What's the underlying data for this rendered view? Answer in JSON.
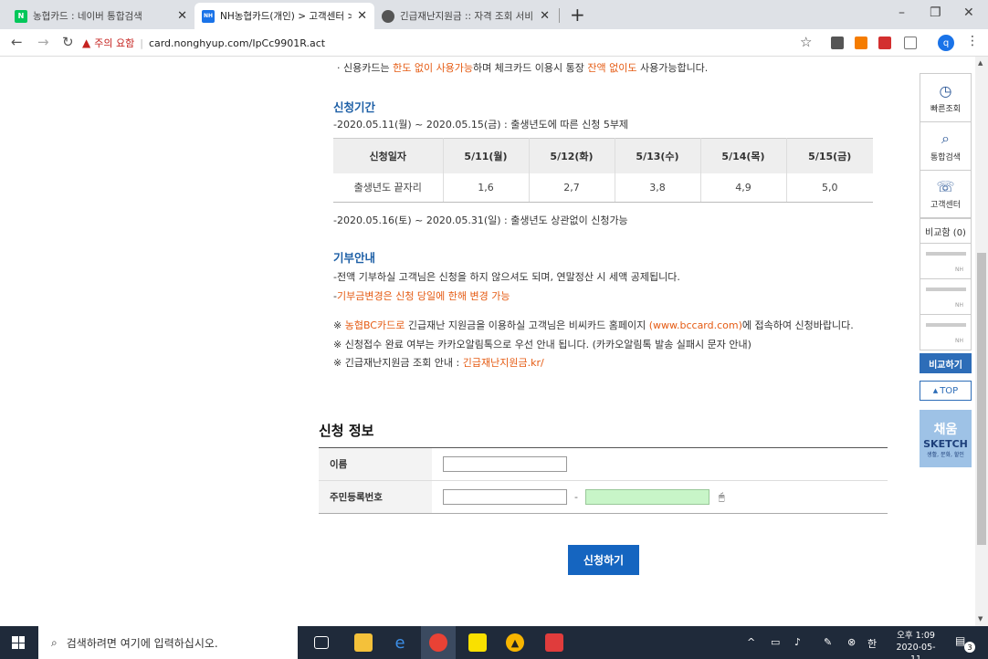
{
  "browser": {
    "tabs": [
      {
        "title": "농협카드 : 네이버 통합검색",
        "favicon": "N",
        "favicon_color": "#03c75a"
      },
      {
        "title": "NH농협카드(개인) > 고객센터 > ㅈ",
        "favicon": "NH",
        "favicon_color": "#1a73e8"
      },
      {
        "title": "긴급재난지원금 :: 자격 조회 서비",
        "favicon": "globe-icon",
        "favicon_color": "#555555"
      }
    ],
    "new_tab": "+",
    "security_warning": "주의 요함",
    "url": "card.nonghyup.com/IpCc9901R.act",
    "profile_initial": "q"
  },
  "content": {
    "top_note": {
      "prefix": "· 신용카드는 ",
      "hl1": "한도 없이 사용가능",
      "mid": "하며 체크카드 이용시 통장 ",
      "hl2": "잔액 없이도",
      "suffix": " 사용가능합니다."
    },
    "period": {
      "title": "신청기간",
      "line1": "-2020.05.11(월) ~ 2020.05.15(금) : 출생년도에 따른 신청 5부제",
      "table": {
        "headers": [
          "신청일자",
          "5/11(월)",
          "5/12(화)",
          "5/13(수)",
          "5/14(목)",
          "5/15(금)"
        ],
        "row": [
          "출생년도 끝자리",
          "1,6",
          "2,7",
          "3,8",
          "4,9",
          "5,0"
        ]
      },
      "line2": "-2020.05.16(토) ~ 2020.05.31(일) : 출생년도 상관없이 신청가능"
    },
    "donation": {
      "title": "기부안내",
      "line1": "-전액 기부하실 고객님은 신청을 하지 않으셔도 되며, 연말정산 시 세액 공제됩니다.",
      "line2_dash": "-",
      "line2_hl": "기부금변경은 신청 당일에 한해 변경 가능"
    },
    "notes": {
      "n1_prefix": "※ ",
      "n1_hl": "농협BC카드로",
      "n1_mid": " 긴급재난 지원금을 이용하실 고객님은 비씨카드 홈페이지 ",
      "n1_link": "(www.bccard.com)",
      "n1_suffix": "에 접속하여 신청바랍니다.",
      "n2": "※ 신청접수 완료 여부는 카카오알림톡으로 우선 안내 됩니다. (카카오알림톡 발송 실패시 문자 안내)",
      "n3_prefix": "※ 긴급재난지원금 조회 안내 : ",
      "n3_link": "긴급재난지원금.kr/"
    },
    "form": {
      "title": "신청 정보",
      "name_label": "이름",
      "rrn_label": "주민등록번호",
      "name_value": "",
      "rrn_front_value": "",
      "rrn_back_value": "",
      "dash": "-",
      "submit_label": "신청하기"
    }
  },
  "quick_panel": {
    "items": [
      {
        "label": "빠른조회",
        "icon": "clock-icon"
      },
      {
        "label": "통합검색",
        "icon": "search-icon"
      },
      {
        "label": "고객센터",
        "icon": "chat-icon"
      }
    ],
    "compare_label": "비교함 (0)",
    "slot_logo": "NH",
    "compare_button": "비교하기",
    "top_button": "TOP",
    "sketch": {
      "line1": "채움",
      "line2": "SKETCH",
      "line3": "생활, 문화, 할인"
    }
  },
  "taskbar": {
    "search_placeholder": "검색하려면 여기에 입력하십시오.",
    "ime": "한",
    "time": "오후 1:09",
    "date": "2020-05-11",
    "notification_count": "3"
  }
}
